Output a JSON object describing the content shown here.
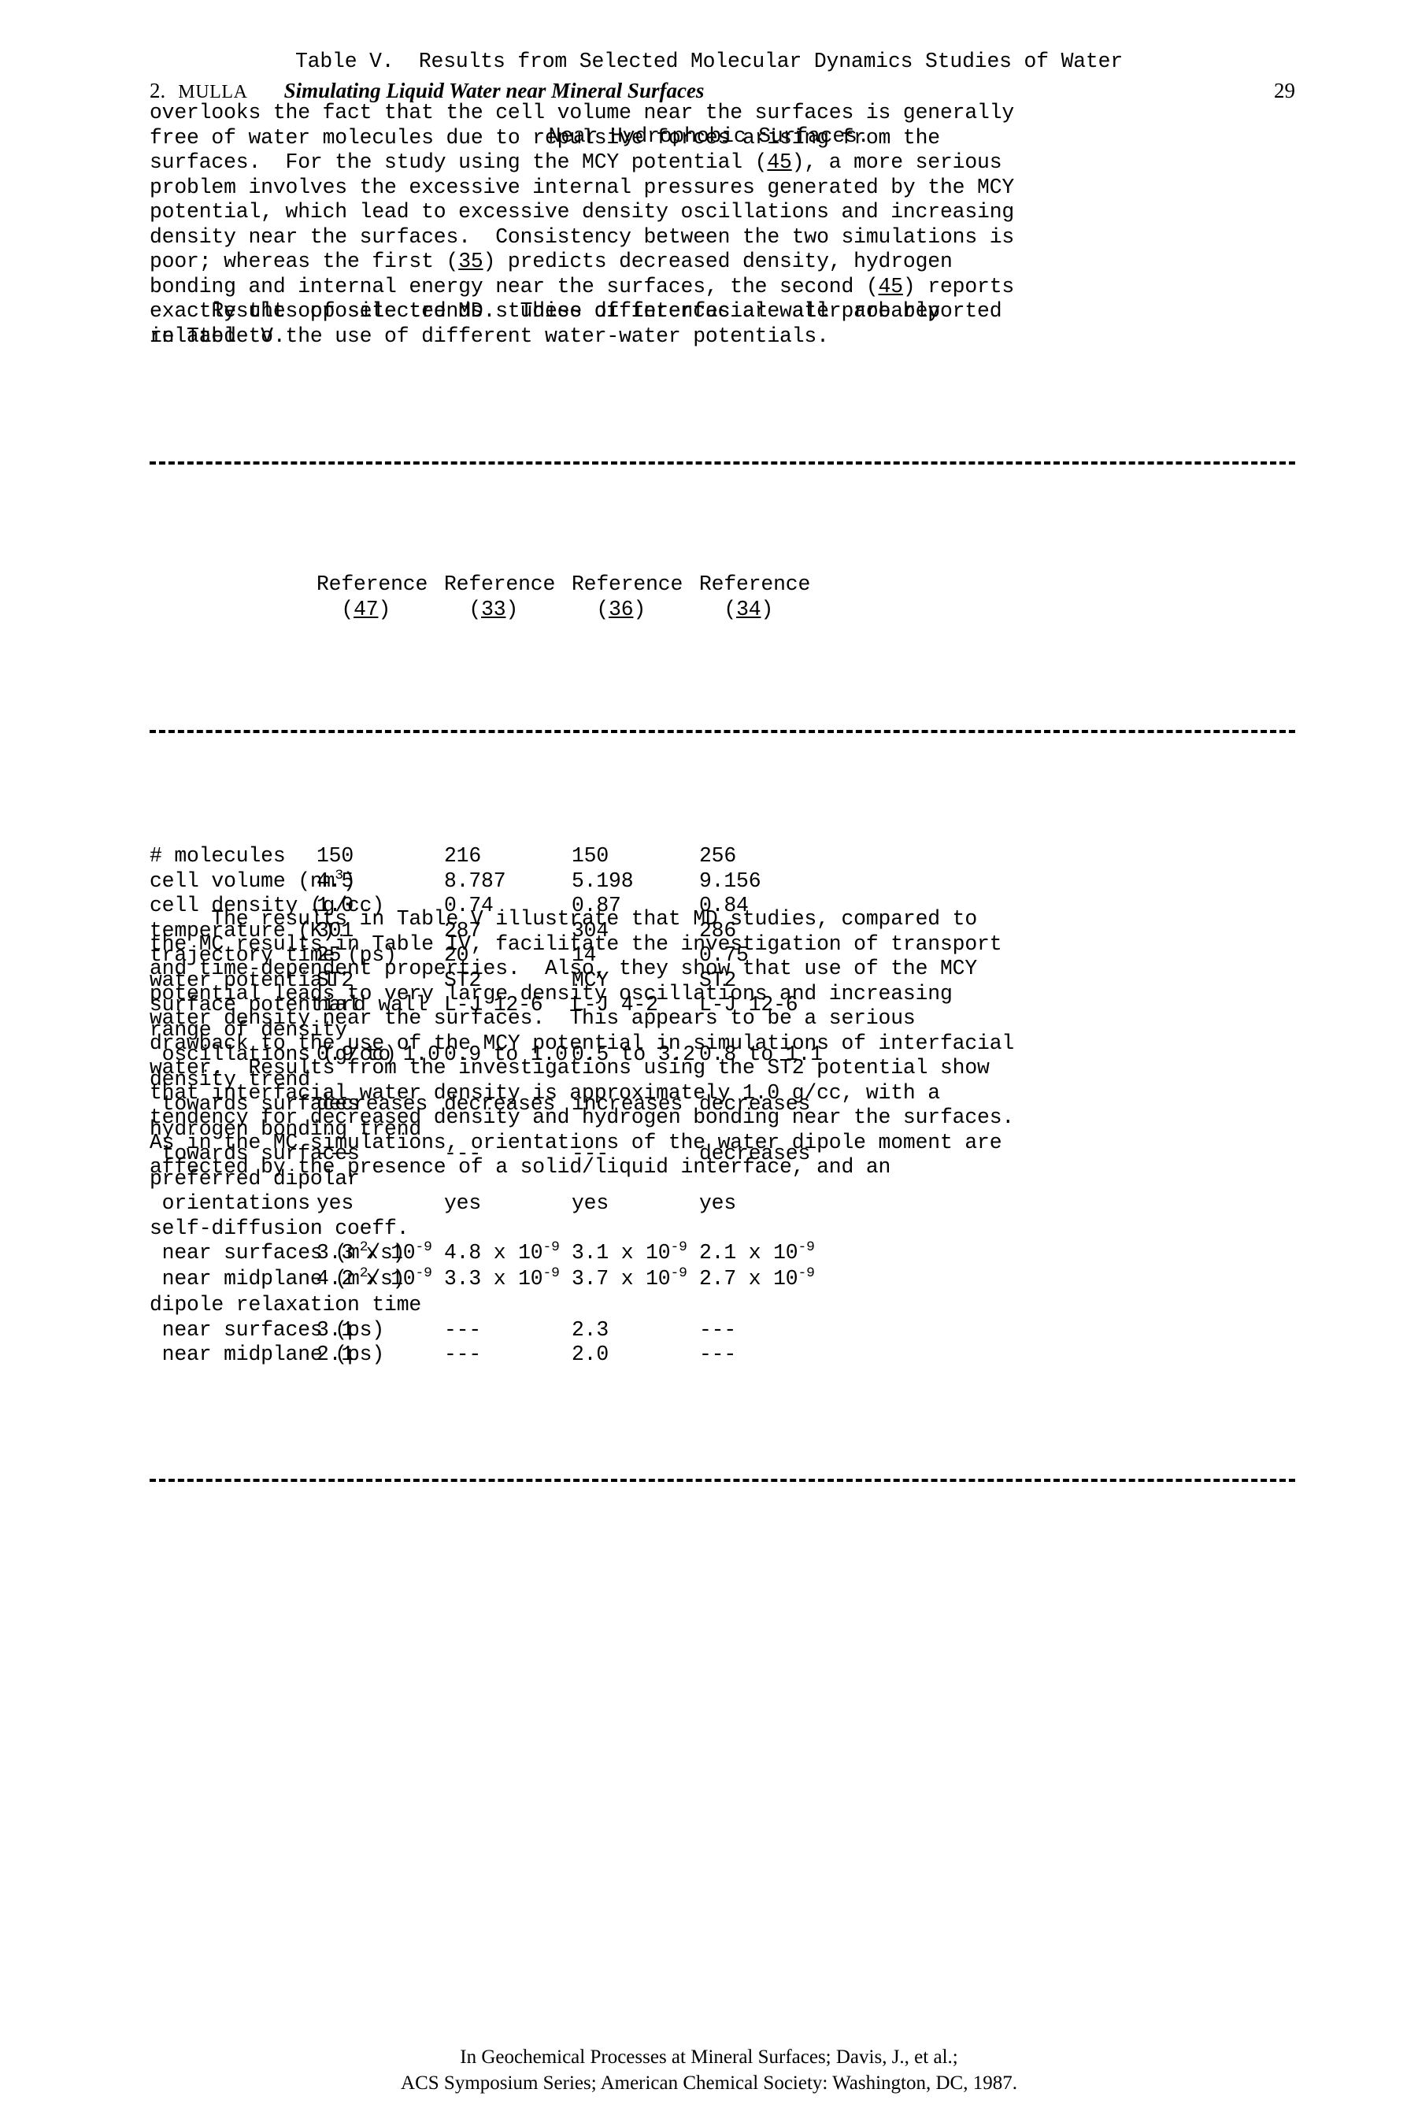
{
  "running_head": {
    "chapter_number": "2.",
    "author": "MULLA",
    "title": "Simulating Liquid Water near Mineral Surfaces",
    "page_number": "29"
  },
  "paragraphs": {
    "p1": [
      "overlooks the fact that the cell volume near the surfaces is generally",
      "free of water molecules due to repulsive forces arising from the",
      "surfaces.  For the study using the MCY potential (45), a more serious",
      "problem involves the excessive internal pressures generated by the MCY",
      "potential, which lead to excessive density oscillations and increasing",
      "density near the surfaces.  Consistency between the two simulations is",
      "poor; whereas the first (35) predicts decreased density, hydrogen",
      "bonding and internal energy near the surfaces, the second (45) reports",
      "exactly the opposite trends.  These differences are all probably",
      "related to the use of different water-water potentials."
    ],
    "p2": [
      "     Results of selected MD studies of interfacial water are reported",
      "in Table V."
    ],
    "p3": [
      "     The results in Table V illustrate that MD studies, compared to",
      "the MC results in Table IV, facilitate the investigation of transport",
      "and time-dependent properties.  Also, they show that use of the MCY",
      "potential leads to very large density oscillations and increasing",
      "water density near the surfaces.  This appears to be a serious",
      "drawback to the use of the MCY potential in simulations of interfacial",
      "water.  Results from the investigations using the ST2 potential show",
      "that interfacial water density is approximately 1.0 g/cc, with a",
      "tendency for decreased density and hydrogen bonding near the surfaces.",
      "As in the MC simulations, orientations of the water dipole moment are",
      "affected by the presence of a solid/liquid interface, and an"
    ]
  },
  "table": {
    "caption_line1": "Table V.  Results from Selected Molecular Dynamics Studies of Water",
    "caption_line2": "Near Hydrophobic Surfaces.",
    "column_headers": [
      {
        "line1": "Reference",
        "ref_open": "(",
        "ref_num": "47",
        "ref_close": ")"
      },
      {
        "line1": "Reference",
        "ref_open": "(",
        "ref_num": "33",
        "ref_close": ")"
      },
      {
        "line1": "Reference",
        "ref_open": "(",
        "ref_num": "36",
        "ref_close": ")"
      },
      {
        "line1": "Reference",
        "ref_open": "(",
        "ref_num": "34",
        "ref_close": ")"
      }
    ],
    "rows": [
      {
        "label": "# molecules",
        "cells": [
          "150",
          "216",
          "150",
          "256"
        ]
      },
      {
        "label_pre": "cell volume (nm",
        "label_sup": "3",
        "label_post": ")",
        "cells": [
          "4.5",
          "8.787",
          "5.198",
          "9.156"
        ]
      },
      {
        "label": "cell density (g/cc)",
        "cells": [
          "1.0",
          "0.74",
          "0.87",
          "0.84"
        ]
      },
      {
        "label": "temperature (K)",
        "cells": [
          "301",
          "287",
          "304",
          "286"
        ]
      },
      {
        "label": "trajectory time (ps)",
        "cells": [
          "25",
          "20",
          "14",
          "0.75"
        ]
      },
      {
        "label": "water potential",
        "cells": [
          "ST2",
          "ST2",
          "MCY",
          "ST2"
        ]
      },
      {
        "label": "surface potential",
        "cells": [
          "hard wall",
          "L-J 12-6",
          "L-J 4-2",
          "L-J 12-6"
        ]
      },
      {
        "label": "range of density",
        "cells": [
          "",
          "",
          "",
          ""
        ]
      },
      {
        "label": " oscillations (g/cc)",
        "cells": [
          "0.9 to 1.0",
          "0.9 to 1.0",
          "0.5 to 3.2",
          "0.8 to 1.1"
        ]
      },
      {
        "label": "density trend",
        "cells": [
          "",
          "",
          "",
          ""
        ]
      },
      {
        "label": " towards surfaces",
        "cells": [
          "decreases",
          "decreases",
          "increases",
          "decreases"
        ]
      },
      {
        "label": "hydrogen bonding trend",
        "cells": [
          "",
          "",
          "",
          ""
        ]
      },
      {
        "label": " towards surfaces",
        "cells": [
          "---",
          "---",
          "---",
          "decreases"
        ]
      },
      {
        "label": "preferred dipolar",
        "cells": [
          "",
          "",
          "",
          ""
        ]
      },
      {
        "label": " orientations",
        "cells": [
          "yes",
          "yes",
          "yes",
          "yes"
        ]
      },
      {
        "label": "self-diffusion coeff.",
        "cells": [
          "",
          "",
          "",
          ""
        ]
      },
      {
        "label_pre": " near surfaces (m",
        "label_sup": "2",
        "label_post": "/s)",
        "sci_cells": [
          {
            "mantissa": "3.3 x 10",
            "exponent": "-9"
          },
          {
            "mantissa": "4.8 x 10",
            "exponent": "-9"
          },
          {
            "mantissa": "3.1 x 10",
            "exponent": "-9"
          },
          {
            "mantissa": "2.1 x 10",
            "exponent": "-9"
          }
        ]
      },
      {
        "label_pre": " near midplane (m",
        "label_sup": "2",
        "label_post": "/s)",
        "sci_cells": [
          {
            "mantissa": "4.2 x 10",
            "exponent": "-9"
          },
          {
            "mantissa": "3.3 x 10",
            "exponent": "-9"
          },
          {
            "mantissa": "3.7 x 10",
            "exponent": "-9"
          },
          {
            "mantissa": "2.7 x 10",
            "exponent": "-9"
          }
        ]
      },
      {
        "label": "dipole relaxation time",
        "cells": [
          "",
          "",
          "",
          ""
        ]
      },
      {
        "label": " near surfaces (ps)",
        "cells": [
          "3.1",
          "---",
          "2.3",
          "---"
        ]
      },
      {
        "label": " near midplane (ps)",
        "cells": [
          "2.1",
          "---",
          "2.0",
          "---"
        ]
      }
    ]
  },
  "footer": {
    "line1": "In Geochemical Processes at Mineral Surfaces; Davis, J., et al.;",
    "line2": "ACS Symposium Series; American Chemical Society: Washington, DC, 1987."
  }
}
